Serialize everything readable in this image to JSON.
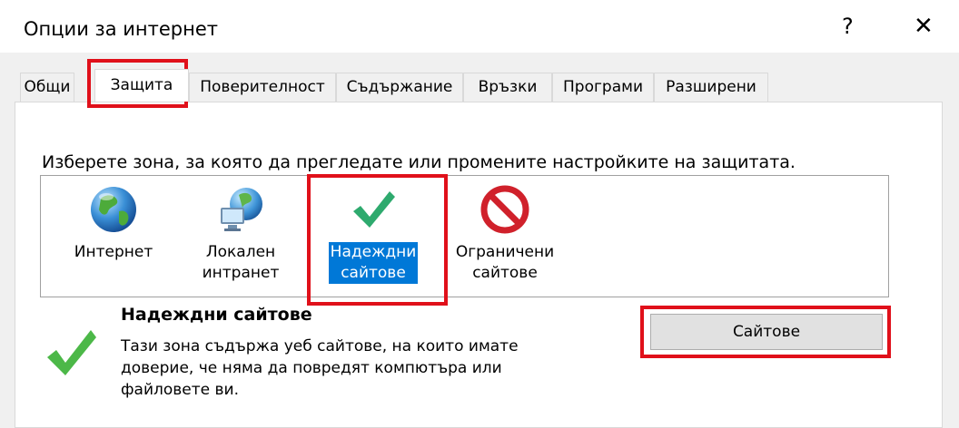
{
  "window": {
    "title": "Опции за интернет",
    "help_label": "?",
    "close_label": "✕"
  },
  "tabs": [
    {
      "label": "Общи"
    },
    {
      "label": "Защита",
      "active": true
    },
    {
      "label": "Поверителност"
    },
    {
      "label": "Съдържание"
    },
    {
      "label": "Връзки"
    },
    {
      "label": "Програми"
    },
    {
      "label": "Разширени"
    }
  ],
  "security": {
    "instruction": "Изберете зона, за която да прегледате или промените настройките на защитата.",
    "zones": [
      {
        "line1": "Интернет",
        "line2": "",
        "icon": "globe-icon"
      },
      {
        "line1": "Локален",
        "line2": "интранет",
        "icon": "intranet-icon"
      },
      {
        "line1": "Надеждни",
        "line2": "сайтове",
        "icon": "checkmark-icon",
        "selected": true
      },
      {
        "line1": "Ограничени",
        "line2": "сайтове",
        "icon": "prohibited-icon"
      }
    ],
    "selected_zone": {
      "title": "Надеждни сайтове",
      "description_lines": [
        "Тази зона съдържа уеб сайтове, на които имате",
        "доверие, че няма да повредят компютъра или",
        "файловете ви."
      ],
      "sites_button_label": "Сайтове"
    }
  },
  "colors": {
    "selection": "#0078d7",
    "highlight_box": "#e0101a",
    "check_green": "#2eaa6e"
  }
}
